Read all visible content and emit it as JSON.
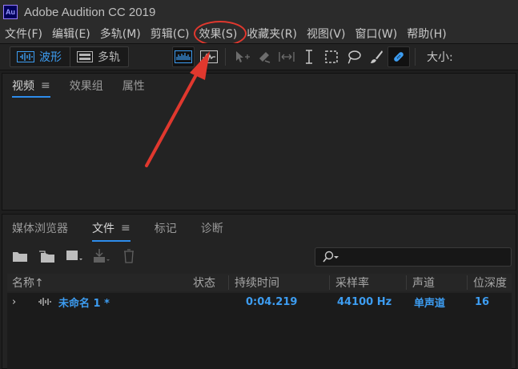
{
  "app": {
    "icon_text": "Au",
    "title": "Adobe Audition CC 2019"
  },
  "menu": {
    "items": [
      {
        "label": "文件(F)",
        "highlighted": false
      },
      {
        "label": "编辑(E)",
        "highlighted": false
      },
      {
        "label": "多轨(M)",
        "highlighted": false
      },
      {
        "label": "剪辑(C)",
        "highlighted": false
      },
      {
        "label": "效果(S)",
        "highlighted": true
      },
      {
        "label": "收藏夹(R)",
        "highlighted": false
      },
      {
        "label": "视图(V)",
        "highlighted": false
      },
      {
        "label": "窗口(W)",
        "highlighted": false
      },
      {
        "label": "帮助(H)",
        "highlighted": false
      }
    ]
  },
  "toolbar": {
    "waveform_label": "波形",
    "multitrack_label": "多轨",
    "active_mode": "waveform",
    "size_label": "大小:",
    "tools": [
      "spectral-frequency-display-icon",
      "spectral-pitch-display-icon",
      "move-tool-icon",
      "razor-tool-icon",
      "slip-tool-icon",
      "time-selection-tool-icon",
      "marquee-selection-tool-icon",
      "lasso-selection-tool-icon",
      "paintbrush-selection-tool-icon",
      "spot-healing-brush-icon"
    ]
  },
  "top_panel": {
    "tabs": [
      {
        "label": "视频",
        "active": true,
        "menu": "≡"
      },
      {
        "label": "效果组",
        "active": false
      },
      {
        "label": "属性",
        "active": false
      }
    ]
  },
  "bottom_panel": {
    "tabs": [
      {
        "label": "媒体浏览器",
        "active": false
      },
      {
        "label": "文件",
        "active": true,
        "menu": "≡"
      },
      {
        "label": "标记",
        "active": false
      },
      {
        "label": "诊断",
        "active": false
      }
    ],
    "search": {
      "placeholder": ""
    },
    "columns": [
      "名称",
      "状态",
      "持续时间",
      "采样率",
      "声道",
      "位深度"
    ],
    "sort_indicator": "↑",
    "files": [
      {
        "expander": "›",
        "name": "未命名 1 *",
        "status": "",
        "duration": "0:04.219",
        "sample_rate": "44100 Hz",
        "channels": "单声道",
        "bit_depth": "16"
      }
    ]
  },
  "colors": {
    "accent_blue": "#3d9df2",
    "annotation_red": "#e0382e",
    "panel_bg": "#232323",
    "menubar_bg": "#2b2b2b"
  }
}
